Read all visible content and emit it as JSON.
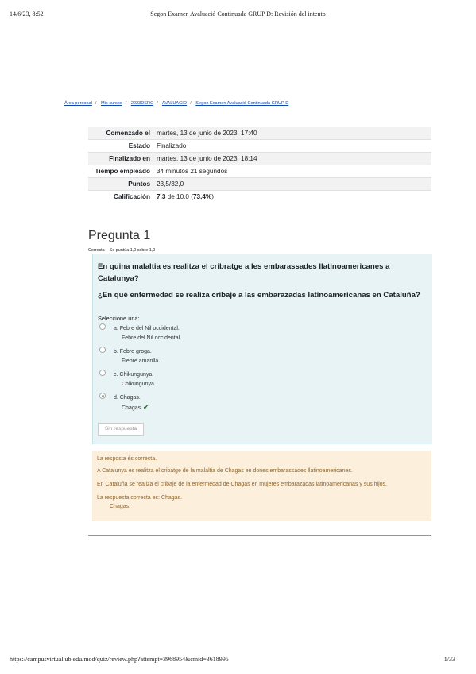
{
  "print_header": {
    "date": "14/6/23, 8:52",
    "title": "Segon Examen Avaluació Continuada GRUP D: Revisión del intento"
  },
  "print_footer": {
    "url": "https://campusvirtual.ub.edu/mod/quiz/review.php?attempt=3968954&cmid=3618995",
    "page": "1/33"
  },
  "breadcrumb": [
    "Área personal",
    "Mis cursos",
    "2223DSRC",
    "AVALUACIO",
    "Segon Examen Avaluació Continuada GRUP D"
  ],
  "summary": [
    {
      "label": "Comenzado el",
      "value": "martes, 13 de junio de 2023, 17:40"
    },
    {
      "label": "Estado",
      "value": "Finalizado"
    },
    {
      "label": "Finalizado en",
      "value": "martes, 13 de junio de 2023, 18:14"
    },
    {
      "label": "Tiempo empleado",
      "value": "34 minutos 21 segundos"
    },
    {
      "label": "Puntos",
      "value": "23,5/32,0"
    },
    {
      "label": "Calificación",
      "value_bold": "7,3",
      "value_rest": " de 10,0 (",
      "value_pct": "73,4%",
      "value_end": ")"
    }
  ],
  "question": {
    "heading": "Pregunta 1",
    "status": "Correcta",
    "points": "Se puntúa 1,0 sobre 1,0",
    "text_ca": "En quina malaltia es realitza el cribratge a les embarassades llatinoamericanes a Catalunya?",
    "text_es": "¿En qué enfermedad se realiza cribaje a las embarazadas latinoamericanas en Cataluña?",
    "prompt": "Seleccione una:",
    "options": [
      {
        "label": "a. Febre del Nil occidental.",
        "sub": "Febre del Nil occidental.",
        "checked": false,
        "correct": false
      },
      {
        "label": "b. Febre groga.",
        "sub": "Fiebre amarilla.",
        "checked": false,
        "correct": false
      },
      {
        "label": "c. Chikungunya.",
        "sub": "Chikungunya.",
        "checked": false,
        "correct": false
      },
      {
        "label": "d. Chagas.",
        "sub": "Chagas.",
        "checked": true,
        "correct": true
      }
    ],
    "no_answer_button": "Sin respuesta"
  },
  "feedback": {
    "line1": "La resposta és correcta.",
    "line2": "A Catalunya es realitza el cribatge de la malaltia de Chagas en dones embarassades llatinoamericanes.",
    "line3": "En Cataluña se realiza el cribaje de la enfermedad de Chagas en mujeres embarazadas latinoamericanas y sus hijos.",
    "line4": "La respuesta correcta es: Chagas.",
    "line5": "Chagas."
  },
  "colors": {
    "link": "#0f47ad",
    "formulation_bg": "#e7f3f5",
    "outcome_bg": "#fcefdc",
    "outcome_text": "#8e662e",
    "correct_check": "#357a32"
  }
}
